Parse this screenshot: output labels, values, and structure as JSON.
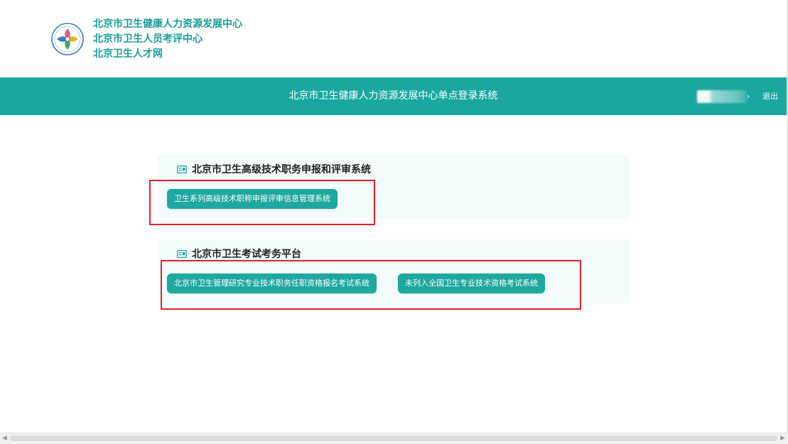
{
  "header": {
    "org_names": [
      "北京市卫生健康人力资源发展中心",
      "北京市卫生人员考评中心",
      "北京卫生人才网"
    ]
  },
  "banner": {
    "title": "北京市卫生健康人力资源发展中心单点登录系统",
    "user_chevron": "›",
    "logout_label": "退出"
  },
  "sections": [
    {
      "title": "北京市卫生高级技术职务申报和评审系统",
      "buttons": [
        "卫生系列高级技术职称申报评审信息管理系统"
      ]
    },
    {
      "title": "北京市卫生考试考务平台",
      "buttons": [
        "北京市卫生管理研究专业技术职务任职资格报名考试系统",
        "未列入全国卫生专业技术资格考试系统"
      ]
    }
  ],
  "scrollbar": {
    "left_arrow": "◀",
    "right_arrow": "▶"
  },
  "colors": {
    "brand_teal": "#1aa7a0",
    "button_teal": "#1ea89f",
    "highlight_red": "#e0212a",
    "org_text": "#1a9e9a"
  },
  "icons": {
    "logo": "logo-emblem",
    "section_title": "list-card-icon"
  }
}
